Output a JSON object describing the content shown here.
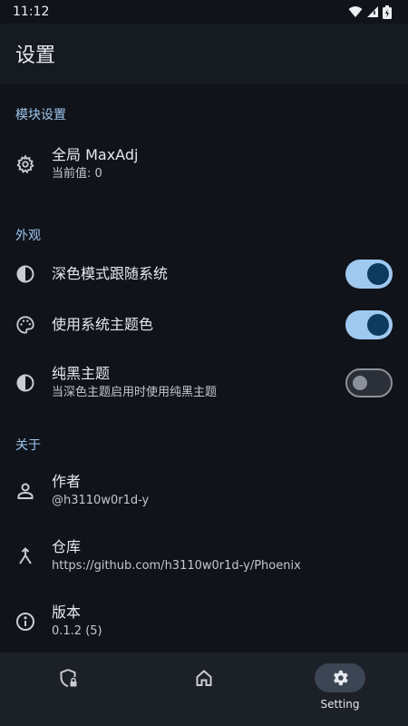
{
  "status_bar": {
    "time": "11:12"
  },
  "app_bar": {
    "title": "设置"
  },
  "sections": {
    "module": {
      "header": "模块设置",
      "global_maxadj": {
        "title": "全局 MaxAdj",
        "subtitle": "当前值: 0",
        "icon": "gear-icon"
      }
    },
    "appearance": {
      "header": "外观",
      "dark_follow_system": {
        "title": "深色模式跟随系统",
        "icon": "contrast-icon",
        "enabled": true
      },
      "system_theme_color": {
        "title": "使用系统主题色",
        "icon": "palette-icon",
        "enabled": true
      },
      "pure_black": {
        "title": "纯黑主题",
        "subtitle": "当深色主题启用时使用纯黑主题",
        "icon": "contrast-icon",
        "enabled": false
      }
    },
    "about": {
      "header": "关于",
      "author": {
        "title": "作者",
        "subtitle": "@h3110w0r1d-y",
        "icon": "person-icon"
      },
      "repo": {
        "title": "仓库",
        "subtitle": "https://github.com/h3110w0r1d-y/Phoenix",
        "icon": "merge-icon"
      },
      "version": {
        "title": "版本",
        "subtitle": "0.1.2 (5)",
        "icon": "info-icon"
      }
    }
  },
  "bottom_nav": {
    "items": [
      {
        "icon": "shield-lock-icon",
        "label": ""
      },
      {
        "icon": "home-icon",
        "label": ""
      },
      {
        "icon": "settings-icon",
        "label": "Setting",
        "active": true
      }
    ]
  },
  "colors": {
    "background": "#10141a",
    "accent": "#9fc6ee",
    "switch_on_track": "#a0c9f0",
    "switch_on_thumb": "#0d3a5f"
  }
}
